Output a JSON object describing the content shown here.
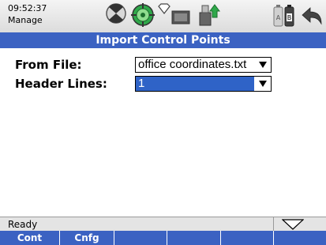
{
  "status": {
    "time": "09:52:37",
    "mode": "Manage"
  },
  "icons": [
    "satellite-off-icon",
    "gps-target-icon",
    "radio-signal-icon",
    "connection-icon",
    "usb-upload-icon",
    "battery-ab-icon",
    "back-arrow-icon"
  ],
  "title": "Import Control Points",
  "form": {
    "from_file_label": "From File:",
    "from_file_value": "office coordinates.txt",
    "header_lines_label": "Header Lines:",
    "header_lines_value": "1"
  },
  "statusbar": {
    "text": "Ready"
  },
  "softkeys": [
    "Cont",
    "Cnfg",
    "",
    "",
    "",
    ""
  ],
  "colors": {
    "title_bg": "#3b62c2",
    "selection": "#2f63c7",
    "accent_green": "#2fa84a"
  }
}
